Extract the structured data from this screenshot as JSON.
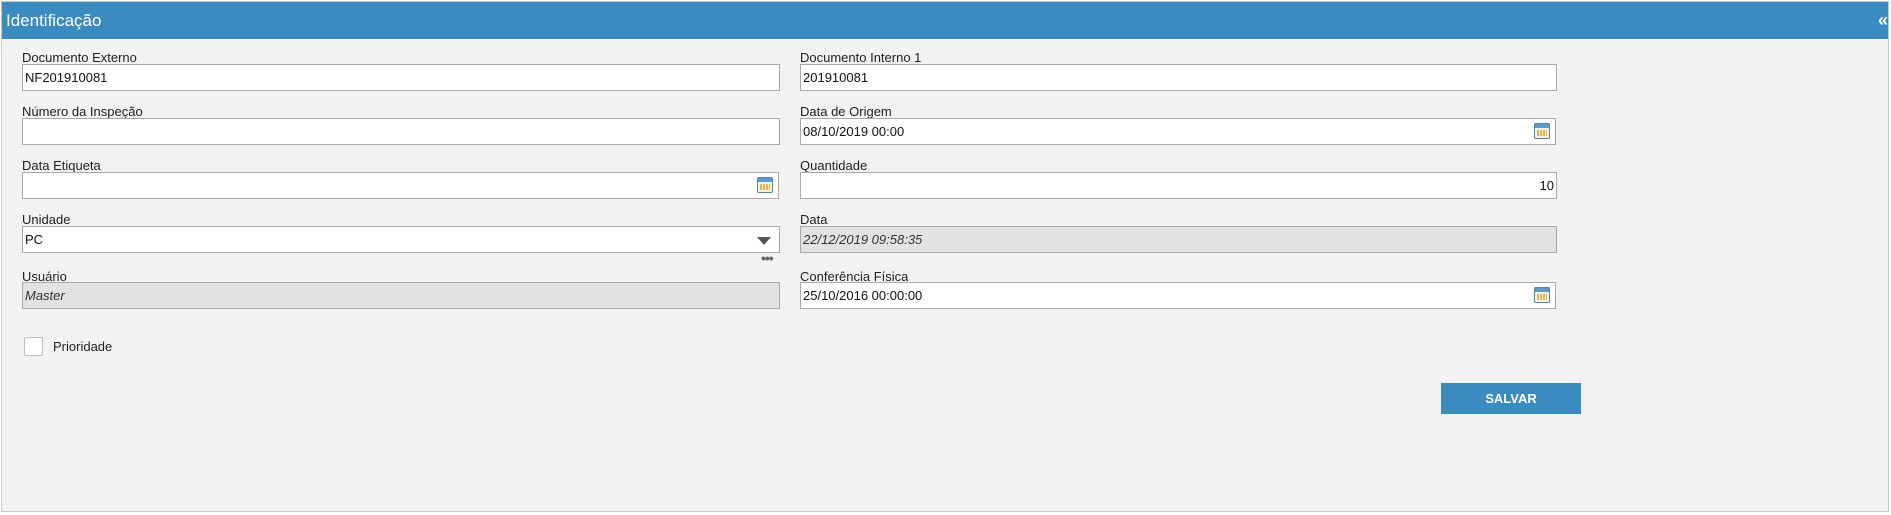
{
  "header": {
    "title": "Identificação",
    "collapse_icon": "«"
  },
  "fields": {
    "documento_externo": {
      "label": "Documento Externo",
      "value": "NF201910081"
    },
    "documento_interno": {
      "label": "Documento Interno 1",
      "value": "201910081"
    },
    "numero_inspecao": {
      "label": "Número da Inspeção",
      "value": ""
    },
    "data_origem": {
      "label": "Data de Origem",
      "value": "08/10/2019 00:00"
    },
    "data_etiqueta": {
      "label": "Data Etiqueta",
      "value": ""
    },
    "quantidade": {
      "label": "Quantidade",
      "value": "10"
    },
    "unidade": {
      "label": "Unidade",
      "value": "PC",
      "more_icon": "•••"
    },
    "data": {
      "label": "Data",
      "value": "22/12/2019 09:58:35"
    },
    "usuario": {
      "label": "Usuário",
      "value": "Master"
    },
    "conferencia_fisica": {
      "label": "Conferência Física",
      "value": "25/10/2016 00:00:00"
    }
  },
  "prioridade": {
    "label": "Prioridade",
    "checked": false
  },
  "actions": {
    "save_label": "SALVAR"
  },
  "colors": {
    "accent": "#3a8bbf",
    "panel_bg": "#f2f2f2",
    "readonly_bg": "#e2e2e2"
  }
}
